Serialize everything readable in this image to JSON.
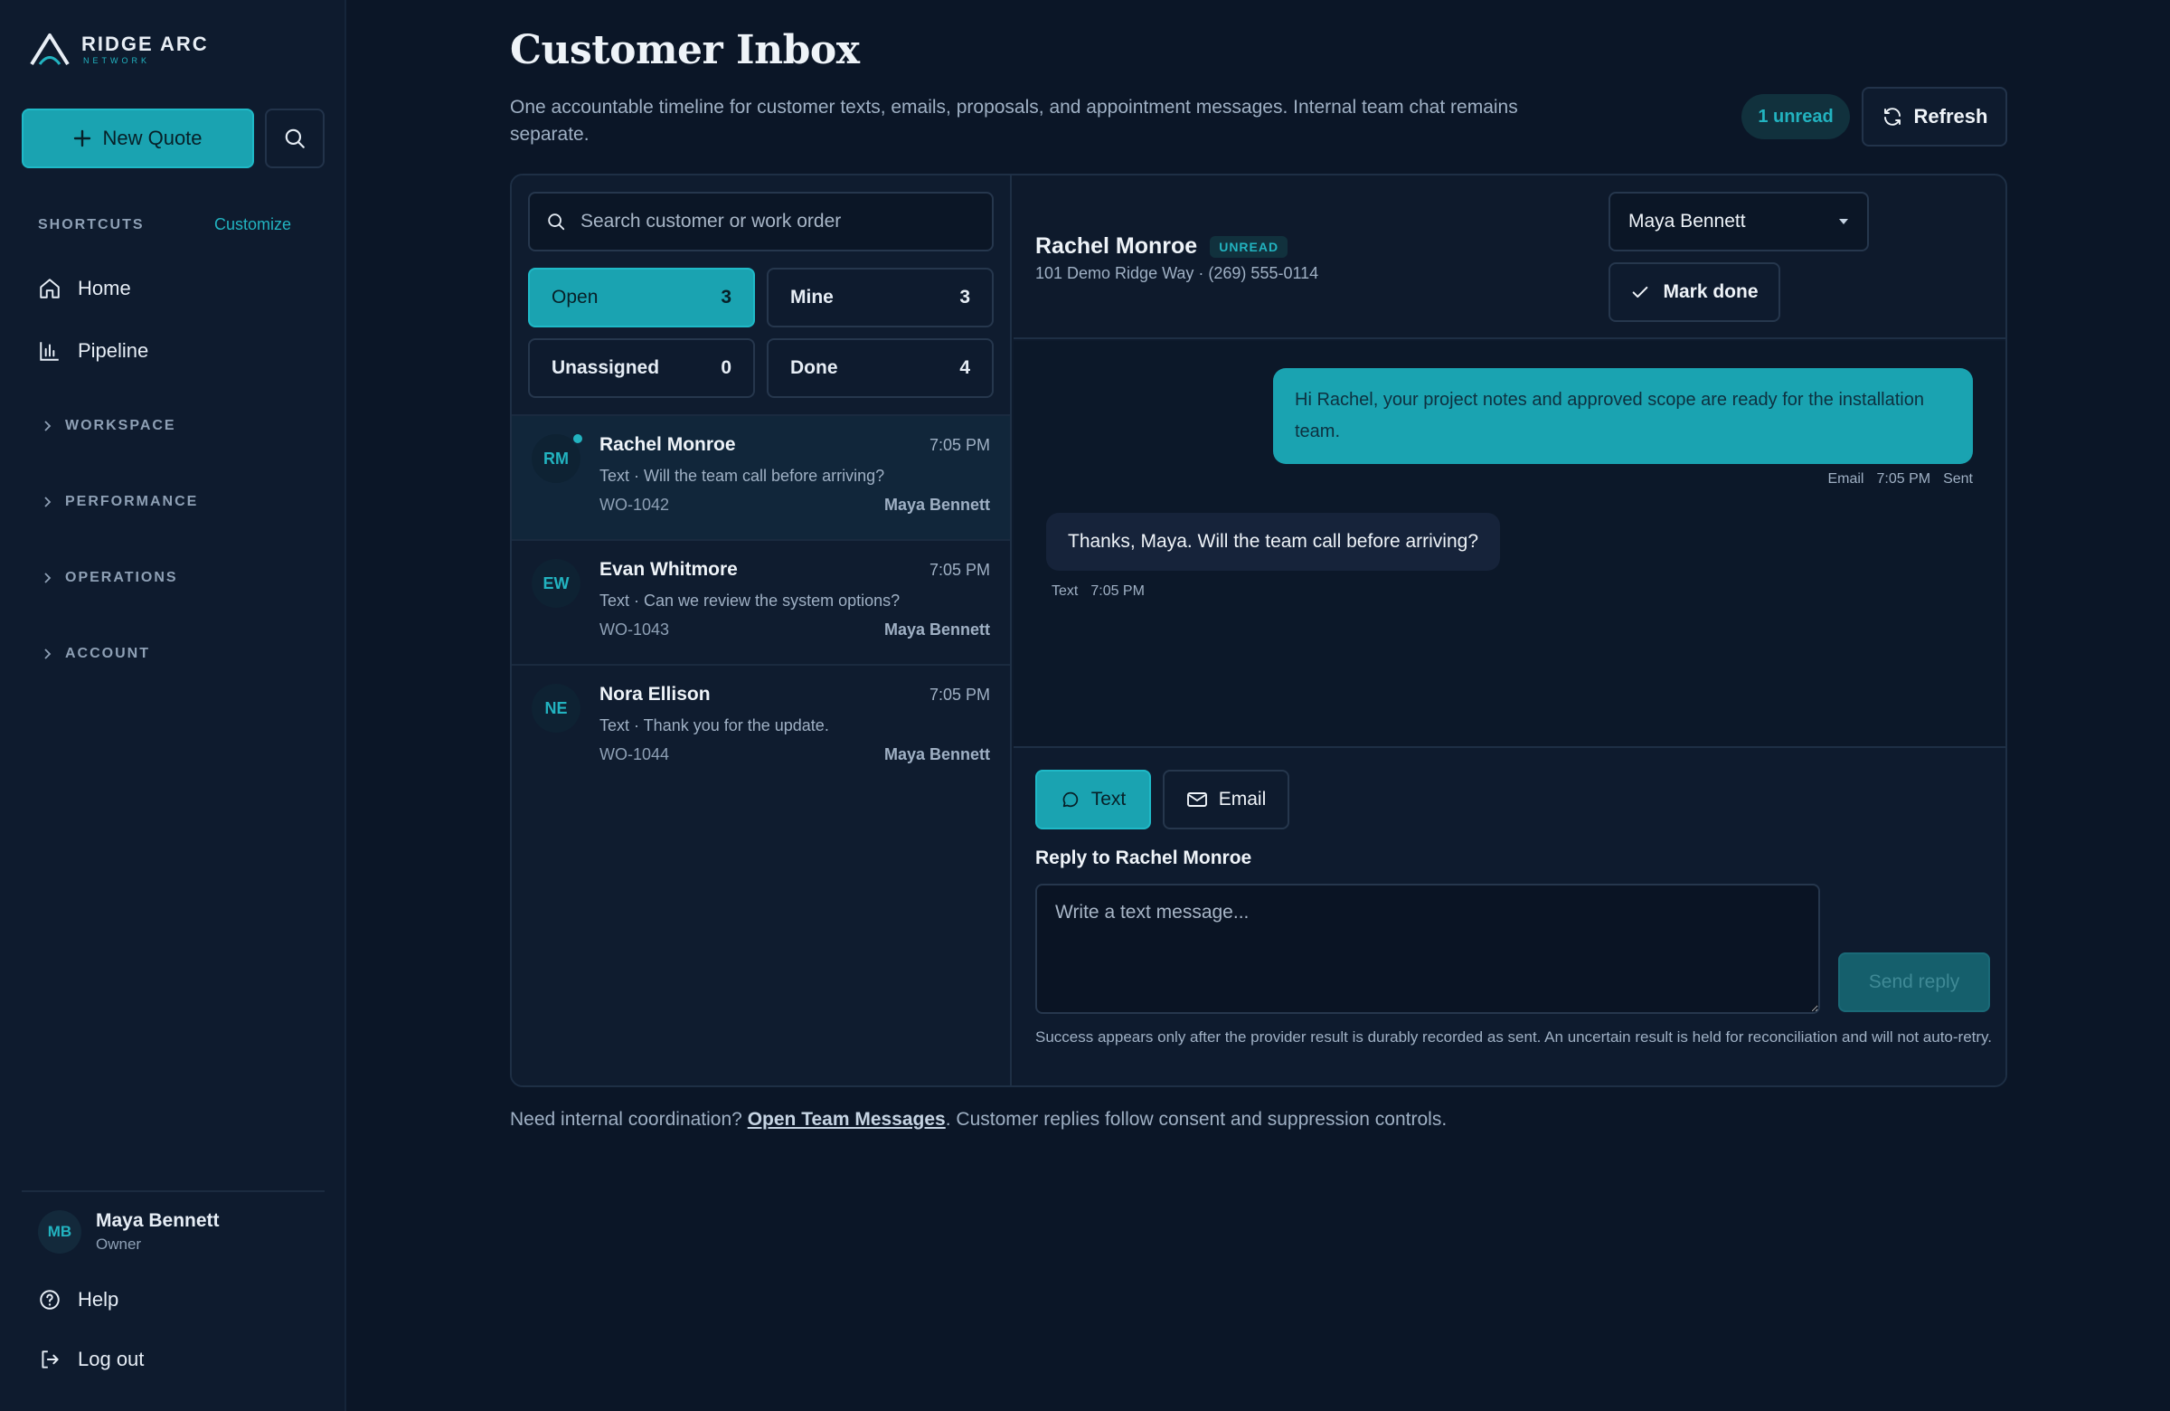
{
  "brand": {
    "name": "RIDGE ARC",
    "tagline": "NETWORK"
  },
  "sidebar": {
    "new_quote_label": "New Quote",
    "shortcuts_label": "SHORTCUTS",
    "customize_label": "Customize",
    "nav": [
      {
        "label": "Home",
        "icon": "home-icon"
      },
      {
        "label": "Pipeline",
        "icon": "chart-icon"
      }
    ],
    "sections": [
      "WORKSPACE",
      "PERFORMANCE",
      "OPERATIONS",
      "ACCOUNT"
    ],
    "user": {
      "initials": "MB",
      "name": "Maya Bennett",
      "role": "Owner"
    },
    "help_label": "Help",
    "logout_label": "Log out"
  },
  "header": {
    "title": "Customer Inbox",
    "subtitle": "One accountable timeline for customer texts, emails, proposals, and appointment messages. Internal team chat remains separate.",
    "unread_label": "1 unread",
    "refresh_label": "Refresh"
  },
  "list": {
    "search_placeholder": "Search customer or work order",
    "filters": [
      {
        "label": "Open",
        "count": "3"
      },
      {
        "label": "Mine",
        "count": "3"
      },
      {
        "label": "Unassigned",
        "count": "0"
      },
      {
        "label": "Done",
        "count": "4"
      }
    ],
    "conversations": [
      {
        "initials": "RM",
        "name": "Rachel Monroe",
        "time": "7:05 PM",
        "preview": "Text · Will the team call before arriving?",
        "work_order": "WO-1042",
        "assignee": "Maya Bennett",
        "unread": true
      },
      {
        "initials": "EW",
        "name": "Evan Whitmore",
        "time": "7:05 PM",
        "preview": "Text · Can we review the system options?",
        "work_order": "WO-1043",
        "assignee": "Maya Bennett",
        "unread": false
      },
      {
        "initials": "NE",
        "name": "Nora Ellison",
        "time": "7:05 PM",
        "preview": "Text · Thank you for the update.",
        "work_order": "WO-1044",
        "assignee": "Maya Bennett",
        "unread": false
      }
    ]
  },
  "detail": {
    "name": "Rachel Monroe",
    "badge": "UNREAD",
    "info": "101 Demo Ridge Way · (269) 555-0114",
    "assignee": "Maya Bennett",
    "mark_done_label": "Mark done",
    "messages": [
      {
        "direction": "out",
        "text": "Hi Rachel, your project notes and approved scope are ready for the installation team.",
        "channel": "Email",
        "time": "7:05 PM",
        "status": "Sent"
      },
      {
        "direction": "in",
        "text": "Thanks, Maya. Will the team call before arriving?",
        "channel": "Text",
        "time": "7:05 PM"
      }
    ]
  },
  "composer": {
    "channels": [
      "Text",
      "Email"
    ],
    "reply_label": "Reply to Rachel Monroe",
    "placeholder": "Write a text message...",
    "send_label": "Send reply",
    "disclaimer": "Success appears only after the provider result is durably recorded as sent. An uncertain result is held for reconciliation and will not auto-retry."
  },
  "footer": {
    "prefix": "Need internal coordination?",
    "link": "Open Team Messages",
    "suffix": ". Customer replies follow consent and suppression controls."
  },
  "colors": {
    "accent": "#1aa3b1",
    "background": "#0b1627",
    "sidebar": "#0e1b2e"
  }
}
